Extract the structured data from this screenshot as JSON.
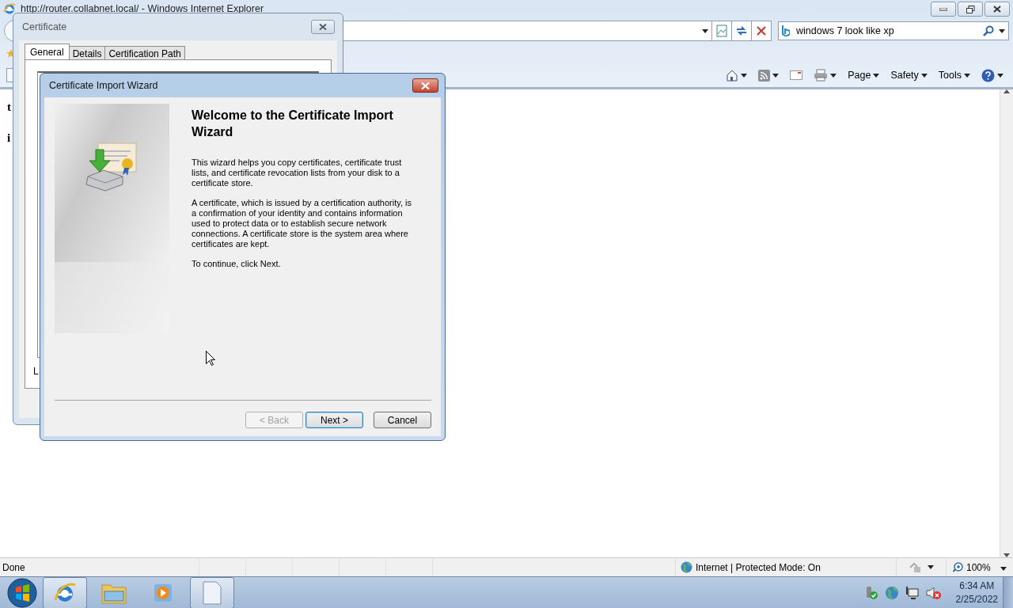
{
  "browser": {
    "title": "http://router.collabnet.local/ - Windows Internet Explorer",
    "search": {
      "value": "windows 7 look like xp"
    },
    "menus": [
      "Page",
      "Safety",
      "Tools"
    ]
  },
  "page_fragments": [
    {
      "text": "t",
      "kind": "bold"
    },
    {
      "text": "i",
      "kind": "bold"
    }
  ],
  "certificate_dialog": {
    "title": "Certificate",
    "tabs": [
      {
        "label": "General",
        "selected": true
      },
      {
        "label": "Details",
        "selected": false
      },
      {
        "label": "Certification Path",
        "selected": false
      }
    ],
    "fragment": "L"
  },
  "wizard": {
    "title": "Certificate Import Wizard",
    "heading": "Welcome to the Certificate Import Wizard",
    "paragraphs": [
      "This wizard helps you copy certificates, certificate trust lists, and certificate revocation lists from your disk to a certificate store.",
      "A certificate, which is issued by a certification authority, is a confirmation of your identity and contains information used to protect data or to establish secure network connections. A certificate store is the system area where certificates are kept.",
      "To continue, click Next."
    ],
    "buttons": [
      {
        "label": "< Back",
        "disabled": true,
        "default": false
      },
      {
        "label": "Next >",
        "disabled": false,
        "default": true
      },
      {
        "label": "Cancel",
        "disabled": false,
        "default": false
      }
    ]
  },
  "status_bar": {
    "text": "Done",
    "zone": "Internet | Protected Mode: On",
    "zoom": "100%"
  },
  "taskbar": {
    "apps": [
      {
        "kind": "browser",
        "selected": true
      },
      {
        "kind": "folder",
        "selected": false
      },
      {
        "kind": "media",
        "selected": false
      },
      {
        "kind": "document",
        "selected": true
      }
    ],
    "time": "6:34 AM",
    "date": "2/25/2022"
  }
}
